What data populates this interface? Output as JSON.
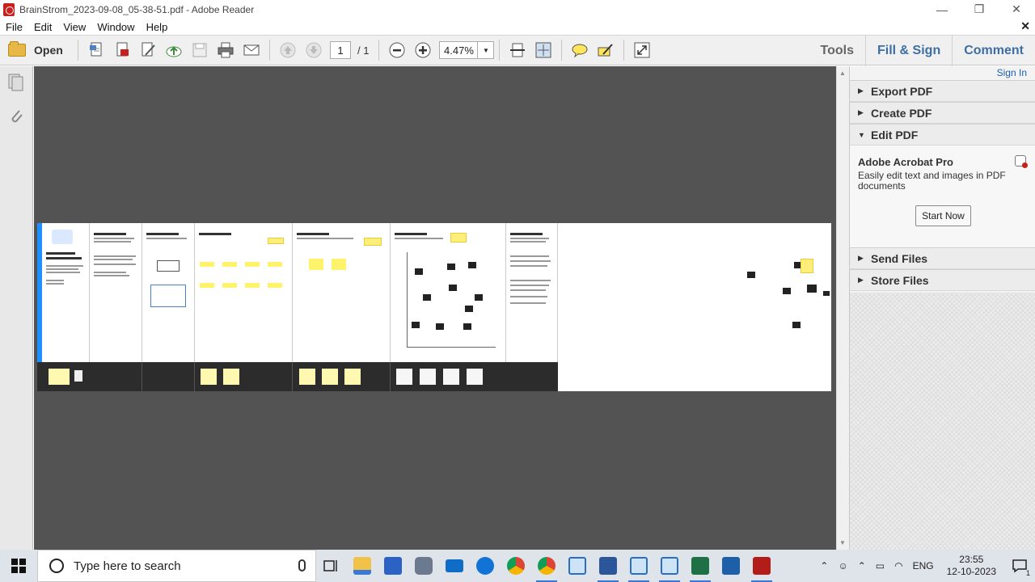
{
  "window": {
    "title": "BrainStrom_2023-09-08_05-38-51.pdf - Adobe Reader",
    "minimize": "—",
    "restore": "❐",
    "close": "✕"
  },
  "menu": {
    "items": [
      "File",
      "Edit",
      "View",
      "Window",
      "Help"
    ],
    "close_doc": "✕"
  },
  "toolbar": {
    "open_label": "Open",
    "page_current": "1",
    "page_total": "/ 1",
    "zoom": "4.47%",
    "tools_tab": "Tools",
    "fill_sign_tab": "Fill & Sign",
    "comment_tab": "Comment"
  },
  "right_panel": {
    "sign_in": "Sign In",
    "sections": [
      {
        "label": "Export PDF",
        "expanded": false
      },
      {
        "label": "Create PDF",
        "expanded": false
      },
      {
        "label": "Edit PDF",
        "expanded": true
      },
      {
        "label": "Send Files",
        "expanded": false
      },
      {
        "label": "Store Files",
        "expanded": false
      }
    ],
    "edit_pdf": {
      "heading": "Adobe Acrobat Pro",
      "description": "Easily edit text and images in PDF documents",
      "button": "Start Now"
    }
  },
  "taskbar": {
    "search_placeholder": "Type here to search",
    "language": "ENG",
    "time": "23:55",
    "date": "12-10-2023",
    "notification_count": "1"
  }
}
